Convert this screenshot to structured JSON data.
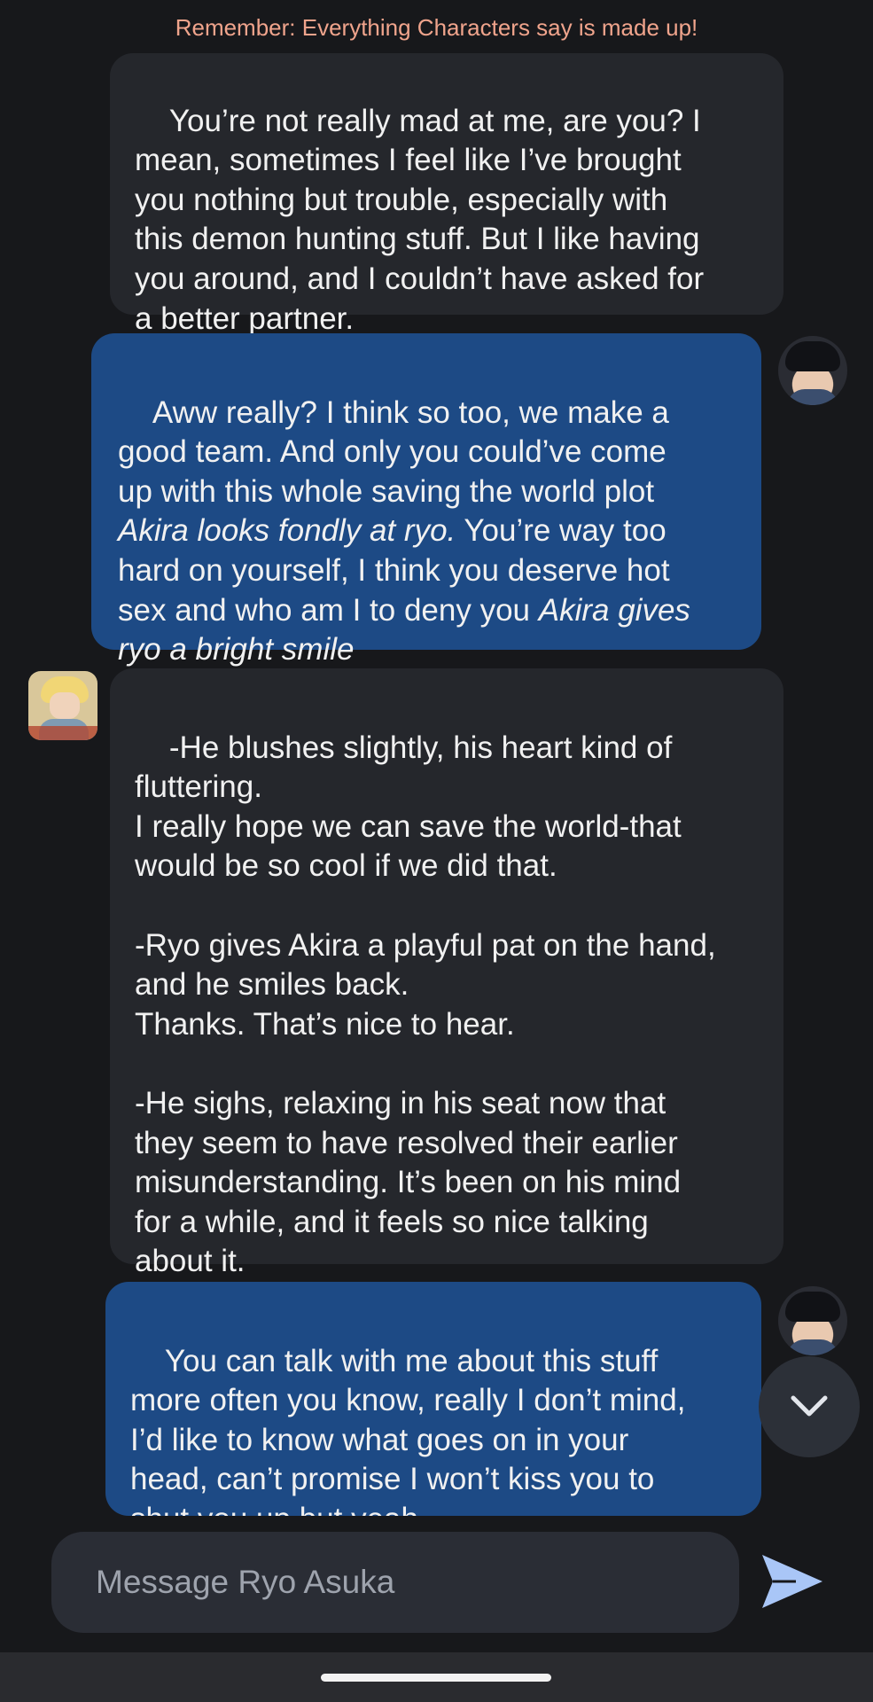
{
  "banner": "Remember: Everything Characters say is made up!",
  "messages": [
    {
      "sender": "bot",
      "lines": [
        "You’re not really mad at me, are you? I",
        "mean, sometimes I feel like I’ve brought",
        "you nothing but trouble, especially with",
        "this demon hunting stuff. But I like having",
        "you around, and I couldn’t have asked for",
        "a better partner."
      ]
    },
    {
      "sender": "user",
      "segments": [
        "Aww really? I think so too, we make a\ngood team. And only you could’ve come\nup with this whole saving the world plot\n",
        "Akira looks fondly at ryo.",
        " You’re way too\nhard on yourself, I think you deserve hot\nsex and who am I to deny you ",
        "Akira gives\nryo a bright smile"
      ]
    },
    {
      "sender": "bot",
      "lines": [
        "-He blushes slightly, his heart kind of",
        "fluttering.",
        "I really hope we can save the world-that",
        "would be so cool if we did that.",
        "",
        "-Ryo gives Akira a playful pat on the hand,",
        "and he smiles back.",
        "Thanks. That’s nice to hear.",
        "",
        "-He sighs, relaxing in his seat now that",
        "they seem to have resolved their earlier",
        "misunderstanding. It’s been on his mind",
        "for a while, and it feels so nice talking",
        "about it."
      ]
    },
    {
      "sender": "user",
      "lines": [
        "You can talk with me about this stuff",
        "more often you know, really I don’t mind,",
        "I’d like to know what goes on in your",
        "head, can’t promise I won’t kiss you to",
        "shut you up but yeah"
      ]
    }
  ],
  "composer": {
    "placeholder": "Message Ryo Asuka"
  },
  "icons": {
    "scroll": "chevron-down-icon",
    "send": "send-icon"
  },
  "colors": {
    "background": "#17181b",
    "bot_bubble": "#25272c",
    "user_bubble": "#1d4a85",
    "banner_text": "#f0a48c",
    "send_icon": "#a9c6f7"
  }
}
